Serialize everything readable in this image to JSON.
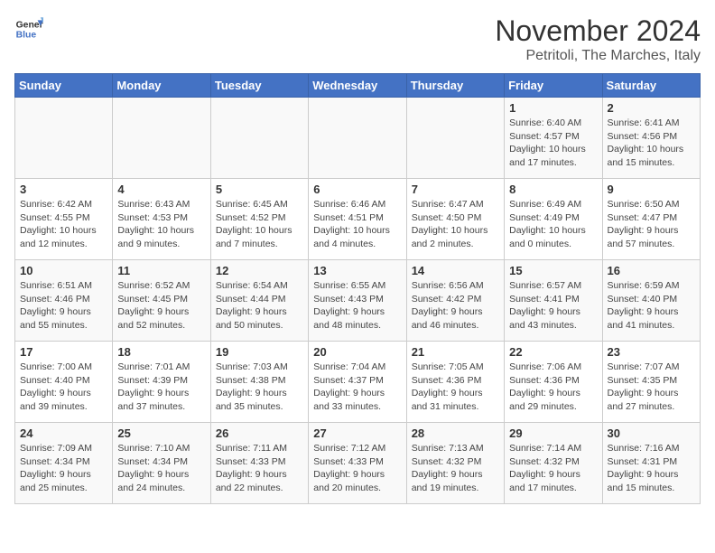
{
  "header": {
    "logo_line1": "General",
    "logo_line2": "Blue",
    "title": "November 2024",
    "subtitle": "Petritoli, The Marches, Italy"
  },
  "days_of_week": [
    "Sunday",
    "Monday",
    "Tuesday",
    "Wednesday",
    "Thursday",
    "Friday",
    "Saturday"
  ],
  "weeks": [
    {
      "days": [
        {
          "number": "",
          "detail": ""
        },
        {
          "number": "",
          "detail": ""
        },
        {
          "number": "",
          "detail": ""
        },
        {
          "number": "",
          "detail": ""
        },
        {
          "number": "",
          "detail": ""
        },
        {
          "number": "1",
          "detail": "Sunrise: 6:40 AM\nSunset: 4:57 PM\nDaylight: 10 hours and 17 minutes."
        },
        {
          "number": "2",
          "detail": "Sunrise: 6:41 AM\nSunset: 4:56 PM\nDaylight: 10 hours and 15 minutes."
        }
      ]
    },
    {
      "days": [
        {
          "number": "3",
          "detail": "Sunrise: 6:42 AM\nSunset: 4:55 PM\nDaylight: 10 hours and 12 minutes."
        },
        {
          "number": "4",
          "detail": "Sunrise: 6:43 AM\nSunset: 4:53 PM\nDaylight: 10 hours and 9 minutes."
        },
        {
          "number": "5",
          "detail": "Sunrise: 6:45 AM\nSunset: 4:52 PM\nDaylight: 10 hours and 7 minutes."
        },
        {
          "number": "6",
          "detail": "Sunrise: 6:46 AM\nSunset: 4:51 PM\nDaylight: 10 hours and 4 minutes."
        },
        {
          "number": "7",
          "detail": "Sunrise: 6:47 AM\nSunset: 4:50 PM\nDaylight: 10 hours and 2 minutes."
        },
        {
          "number": "8",
          "detail": "Sunrise: 6:49 AM\nSunset: 4:49 PM\nDaylight: 10 hours and 0 minutes."
        },
        {
          "number": "9",
          "detail": "Sunrise: 6:50 AM\nSunset: 4:47 PM\nDaylight: 9 hours and 57 minutes."
        }
      ]
    },
    {
      "days": [
        {
          "number": "10",
          "detail": "Sunrise: 6:51 AM\nSunset: 4:46 PM\nDaylight: 9 hours and 55 minutes."
        },
        {
          "number": "11",
          "detail": "Sunrise: 6:52 AM\nSunset: 4:45 PM\nDaylight: 9 hours and 52 minutes."
        },
        {
          "number": "12",
          "detail": "Sunrise: 6:54 AM\nSunset: 4:44 PM\nDaylight: 9 hours and 50 minutes."
        },
        {
          "number": "13",
          "detail": "Sunrise: 6:55 AM\nSunset: 4:43 PM\nDaylight: 9 hours and 48 minutes."
        },
        {
          "number": "14",
          "detail": "Sunrise: 6:56 AM\nSunset: 4:42 PM\nDaylight: 9 hours and 46 minutes."
        },
        {
          "number": "15",
          "detail": "Sunrise: 6:57 AM\nSunset: 4:41 PM\nDaylight: 9 hours and 43 minutes."
        },
        {
          "number": "16",
          "detail": "Sunrise: 6:59 AM\nSunset: 4:40 PM\nDaylight: 9 hours and 41 minutes."
        }
      ]
    },
    {
      "days": [
        {
          "number": "17",
          "detail": "Sunrise: 7:00 AM\nSunset: 4:40 PM\nDaylight: 9 hours and 39 minutes."
        },
        {
          "number": "18",
          "detail": "Sunrise: 7:01 AM\nSunset: 4:39 PM\nDaylight: 9 hours and 37 minutes."
        },
        {
          "number": "19",
          "detail": "Sunrise: 7:03 AM\nSunset: 4:38 PM\nDaylight: 9 hours and 35 minutes."
        },
        {
          "number": "20",
          "detail": "Sunrise: 7:04 AM\nSunset: 4:37 PM\nDaylight: 9 hours and 33 minutes."
        },
        {
          "number": "21",
          "detail": "Sunrise: 7:05 AM\nSunset: 4:36 PM\nDaylight: 9 hours and 31 minutes."
        },
        {
          "number": "22",
          "detail": "Sunrise: 7:06 AM\nSunset: 4:36 PM\nDaylight: 9 hours and 29 minutes."
        },
        {
          "number": "23",
          "detail": "Sunrise: 7:07 AM\nSunset: 4:35 PM\nDaylight: 9 hours and 27 minutes."
        }
      ]
    },
    {
      "days": [
        {
          "number": "24",
          "detail": "Sunrise: 7:09 AM\nSunset: 4:34 PM\nDaylight: 9 hours and 25 minutes."
        },
        {
          "number": "25",
          "detail": "Sunrise: 7:10 AM\nSunset: 4:34 PM\nDaylight: 9 hours and 24 minutes."
        },
        {
          "number": "26",
          "detail": "Sunrise: 7:11 AM\nSunset: 4:33 PM\nDaylight: 9 hours and 22 minutes."
        },
        {
          "number": "27",
          "detail": "Sunrise: 7:12 AM\nSunset: 4:33 PM\nDaylight: 9 hours and 20 minutes."
        },
        {
          "number": "28",
          "detail": "Sunrise: 7:13 AM\nSunset: 4:32 PM\nDaylight: 9 hours and 19 minutes."
        },
        {
          "number": "29",
          "detail": "Sunrise: 7:14 AM\nSunset: 4:32 PM\nDaylight: 9 hours and 17 minutes."
        },
        {
          "number": "30",
          "detail": "Sunrise: 7:16 AM\nSunset: 4:31 PM\nDaylight: 9 hours and 15 minutes."
        }
      ]
    }
  ]
}
